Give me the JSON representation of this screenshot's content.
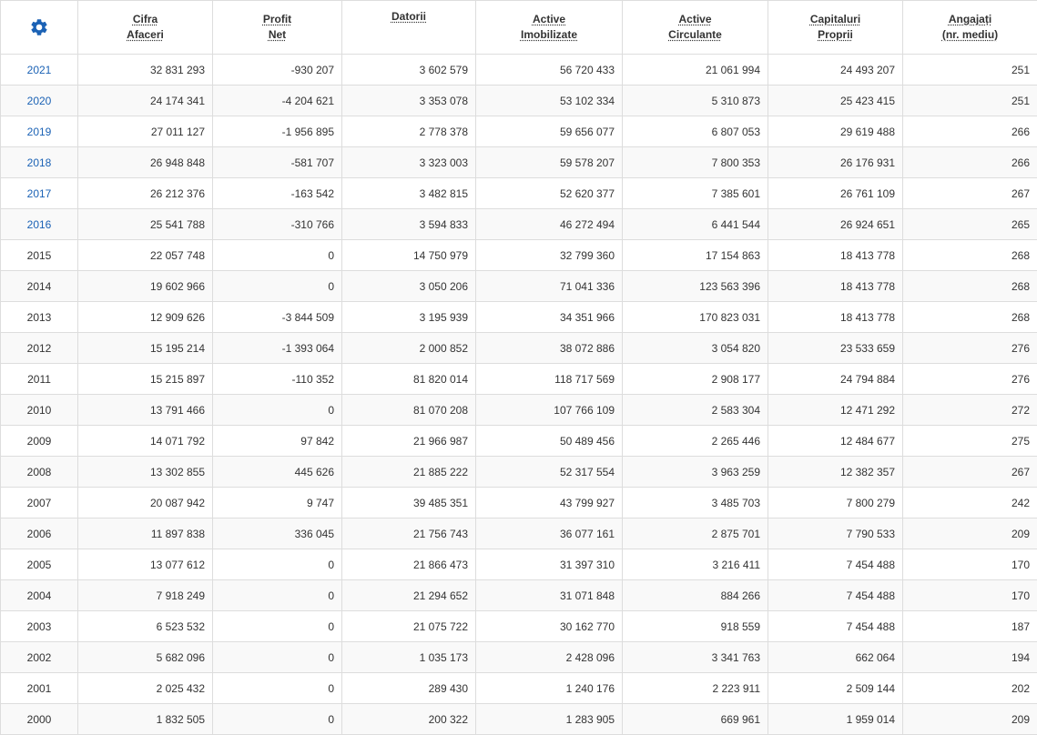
{
  "colors": {
    "accent": "#1b62b5",
    "text": "#333333",
    "border": "#dddddd",
    "stripe": "#f9f9f9"
  },
  "header": {
    "settings_icon": "gear-icon",
    "columns": [
      {
        "line1": "Cifra",
        "line2": "Afaceri"
      },
      {
        "line1": "Profit",
        "line2": "Net"
      },
      {
        "line1": "Datorii",
        "line2": ""
      },
      {
        "line1": "Active",
        "line2": "Imobilizate"
      },
      {
        "line1": "Active",
        "line2": "Circulante"
      },
      {
        "line1": "Capitaluri",
        "line2": "Proprii"
      },
      {
        "line1": "Angajați",
        "line2": "(nr. mediu)"
      }
    ]
  },
  "rows": [
    {
      "year": "2021",
      "link": true,
      "cells": [
        "32 831 293",
        "-930 207",
        "3 602 579",
        "56 720 433",
        "21 061 994",
        "24 493 207",
        "251"
      ]
    },
    {
      "year": "2020",
      "link": true,
      "cells": [
        "24 174 341",
        "-4 204 621",
        "3 353 078",
        "53 102 334",
        "5 310 873",
        "25 423 415",
        "251"
      ]
    },
    {
      "year": "2019",
      "link": true,
      "cells": [
        "27 011 127",
        "-1 956 895",
        "2 778 378",
        "59 656 077",
        "6 807 053",
        "29 619 488",
        "266"
      ]
    },
    {
      "year": "2018",
      "link": true,
      "cells": [
        "26 948 848",
        "-581 707",
        "3 323 003",
        "59 578 207",
        "7 800 353",
        "26 176 931",
        "266"
      ]
    },
    {
      "year": "2017",
      "link": true,
      "cells": [
        "26 212 376",
        "-163 542",
        "3 482 815",
        "52 620 377",
        "7 385 601",
        "26 761 109",
        "267"
      ]
    },
    {
      "year": "2016",
      "link": true,
      "cells": [
        "25 541 788",
        "-310 766",
        "3 594 833",
        "46 272 494",
        "6 441 544",
        "26 924 651",
        "265"
      ]
    },
    {
      "year": "2015",
      "link": false,
      "cells": [
        "22 057 748",
        "0",
        "14 750 979",
        "32 799 360",
        "17 154 863",
        "18 413 778",
        "268"
      ]
    },
    {
      "year": "2014",
      "link": false,
      "cells": [
        "19 602 966",
        "0",
        "3 050 206",
        "71 041 336",
        "123 563 396",
        "18 413 778",
        "268"
      ]
    },
    {
      "year": "2013",
      "link": false,
      "cells": [
        "12 909 626",
        "-3 844 509",
        "3 195 939",
        "34 351 966",
        "170 823 031",
        "18 413 778",
        "268"
      ]
    },
    {
      "year": "2012",
      "link": false,
      "cells": [
        "15 195 214",
        "-1 393 064",
        "2 000 852",
        "38 072 886",
        "3 054 820",
        "23 533 659",
        "276"
      ]
    },
    {
      "year": "2011",
      "link": false,
      "cells": [
        "15 215 897",
        "-110 352",
        "81 820 014",
        "118 717 569",
        "2 908 177",
        "24 794 884",
        "276"
      ]
    },
    {
      "year": "2010",
      "link": false,
      "cells": [
        "13 791 466",
        "0",
        "81 070 208",
        "107 766 109",
        "2 583 304",
        "12 471 292",
        "272"
      ]
    },
    {
      "year": "2009",
      "link": false,
      "cells": [
        "14 071 792",
        "97 842",
        "21 966 987",
        "50 489 456",
        "2 265 446",
        "12 484 677",
        "275"
      ]
    },
    {
      "year": "2008",
      "link": false,
      "cells": [
        "13 302 855",
        "445 626",
        "21 885 222",
        "52 317 554",
        "3 963 259",
        "12 382 357",
        "267"
      ]
    },
    {
      "year": "2007",
      "link": false,
      "cells": [
        "20 087 942",
        "9 747",
        "39 485 351",
        "43 799 927",
        "3 485 703",
        "7 800 279",
        "242"
      ]
    },
    {
      "year": "2006",
      "link": false,
      "cells": [
        "11 897 838",
        "336 045",
        "21 756 743",
        "36 077 161",
        "2 875 701",
        "7 790 533",
        "209"
      ]
    },
    {
      "year": "2005",
      "link": false,
      "cells": [
        "13 077 612",
        "0",
        "21 866 473",
        "31 397 310",
        "3 216 411",
        "7 454 488",
        "170"
      ]
    },
    {
      "year": "2004",
      "link": false,
      "cells": [
        "7 918 249",
        "0",
        "21 294 652",
        "31 071 848",
        "884 266",
        "7 454 488",
        "170"
      ]
    },
    {
      "year": "2003",
      "link": false,
      "cells": [
        "6 523 532",
        "0",
        "21 075 722",
        "30 162 770",
        "918 559",
        "7 454 488",
        "187"
      ]
    },
    {
      "year": "2002",
      "link": false,
      "cells": [
        "5 682 096",
        "0",
        "1 035 173",
        "2 428 096",
        "3 341 763",
        "662 064",
        "194"
      ]
    },
    {
      "year": "2001",
      "link": false,
      "cells": [
        "2 025 432",
        "0",
        "289 430",
        "1 240 176",
        "2 223 911",
        "2 509 144",
        "202"
      ]
    },
    {
      "year": "2000",
      "link": false,
      "cells": [
        "1 832 505",
        "0",
        "200 322",
        "1 283 905",
        "669 961",
        "1 959 014",
        "209"
      ]
    }
  ]
}
